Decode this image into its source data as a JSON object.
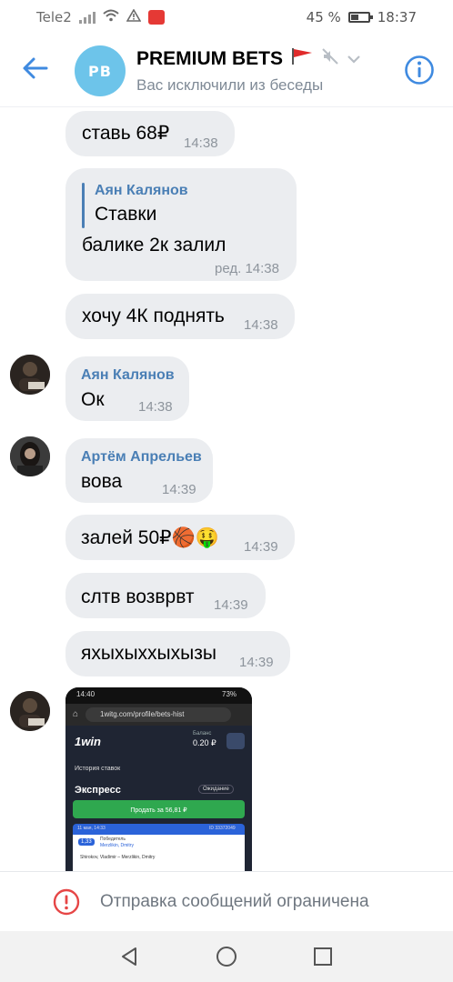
{
  "status_bar": {
    "carrier": "Tele2",
    "battery_percent": "45 %",
    "time": "18:37",
    "battery_level": 0.45
  },
  "header": {
    "avatar_initials": "PB",
    "title": "PREMIUM BETS",
    "subtitle": "Вас исключили из беседы",
    "accent": "#3f8ae0"
  },
  "messages": [
    {
      "text": "ставь 68₽",
      "time": "14:38"
    },
    {
      "reply_name": "Аян Калянов",
      "reply_text": "Ставки",
      "text": "балике 2к залил",
      "time": "ред. 14:38"
    },
    {
      "text": "хочу 4К поднять",
      "time": "14:38"
    },
    {
      "name": "Аян Калянов",
      "text": "Ок",
      "time": "14:38"
    },
    {
      "name": "Артём Апрельев",
      "text": "вова",
      "time": "14:39"
    },
    {
      "text": "залей 50₽🏀🤑",
      "time": "14:39"
    },
    {
      "text": "слтв возврвт",
      "time": "14:39"
    },
    {
      "text": "яхыхыххыхызы",
      "time": "14:39"
    }
  ],
  "attachment": {
    "status_time": "14:40",
    "status_battery": "73%",
    "url": "1witg.com/profile/bets-hist",
    "brand": "1win",
    "balance_label": "Баланс",
    "balance": "0.20 ₽",
    "history_link": "История ставок",
    "bet_type": "Экспресс",
    "bet_status": "Ожидание",
    "sell_button": "Продать за 56,81 ₽",
    "ticket_date": "11 мая, 14:33",
    "ticket_id": "ID 33372049",
    "coef": "1,33",
    "outcome_label": "Победитель",
    "outcome_value": "Merzlikin, Dmitry",
    "match": "Shirokov, Vladimir – Merzlikin, Dmitry"
  },
  "footer": {
    "restriction_text": "Отправка сообщений ограничена"
  }
}
